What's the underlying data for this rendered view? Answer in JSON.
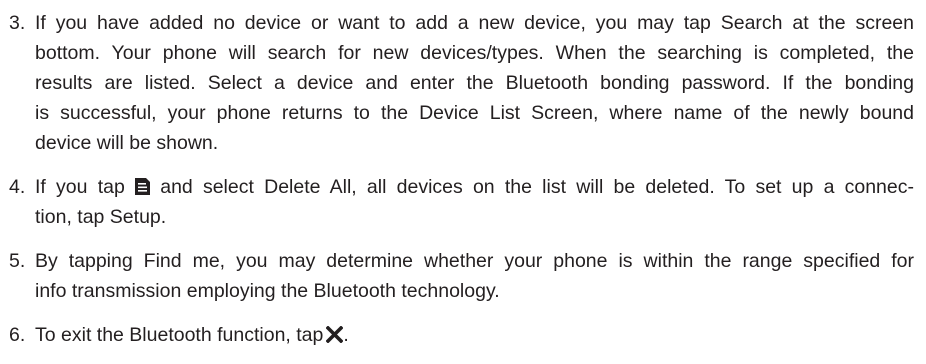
{
  "steps": [
    {
      "number": "3.",
      "lines": [
        "If you have added no device or want to add a new device, you may tap Search at the screen",
        "bottom. Your phone will search for new devices/types. When the searching is completed, the",
        "results are listed. Select a device and enter the Bluetooth bonding password. If the bonding",
        "is successful, your phone returns to the Device List Screen, where name of the newly bound",
        "device will be shown."
      ]
    },
    {
      "number": "4.",
      "line1_before_icon": "If you tap ",
      "icon": "menu-icon",
      "line1_after_icon": " and select Delete All, all devices on the list will be deleted. To set up a connec-",
      "line2": "tion, tap Setup."
    },
    {
      "number": "5.",
      "lines": [
        "By tapping Find me, you may determine whether your phone is within the range specified for",
        "info transmission employing the Bluetooth technology."
      ]
    },
    {
      "number": "6.",
      "text_before_icon": "To exit the Bluetooth function, tap",
      "icon": "close-x-icon",
      "text_after_icon": "."
    }
  ]
}
